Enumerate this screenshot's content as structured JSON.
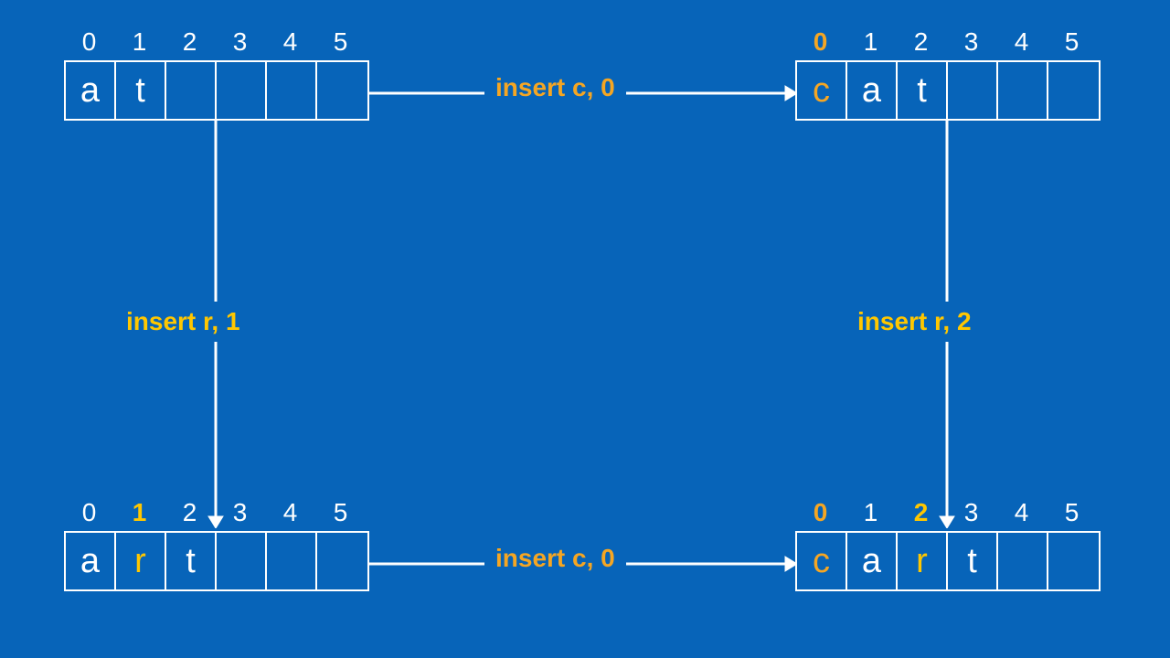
{
  "arrays": {
    "top_left": {
      "indices": [
        "0",
        "1",
        "2",
        "3",
        "4",
        "5"
      ],
      "index_styles": [
        "",
        "",
        "",
        "",
        "",
        ""
      ],
      "cells": [
        "a",
        "t",
        "",
        "",
        "",
        ""
      ],
      "cell_styles": [
        "",
        "",
        "",
        "",
        "",
        ""
      ]
    },
    "top_right": {
      "indices": [
        "0",
        "1",
        "2",
        "3",
        "4",
        "5"
      ],
      "index_styles": [
        "hl-orange",
        "",
        "",
        "",
        "",
        ""
      ],
      "cells": [
        "c",
        "a",
        "t",
        "",
        "",
        ""
      ],
      "cell_styles": [
        "orange",
        "",
        "",
        "",
        "",
        ""
      ]
    },
    "bottom_left": {
      "indices": [
        "0",
        "1",
        "2",
        "3",
        "4",
        "5"
      ],
      "index_styles": [
        "",
        "hl-yellow",
        "",
        "",
        "",
        ""
      ],
      "cells": [
        "a",
        "r",
        "t",
        "",
        "",
        ""
      ],
      "cell_styles": [
        "",
        "yellow",
        "",
        "",
        "",
        ""
      ]
    },
    "bottom_right": {
      "indices": [
        "0",
        "1",
        "2",
        "3",
        "4",
        "5"
      ],
      "index_styles": [
        "hl-orange",
        "",
        "hl-yellow",
        "",
        "",
        ""
      ],
      "cells": [
        "c",
        "a",
        "r",
        "t",
        "",
        ""
      ],
      "cell_styles": [
        "orange",
        "",
        "yellow",
        "",
        "",
        ""
      ]
    }
  },
  "operations": {
    "top": "insert c, 0",
    "bottom": "insert c, 0",
    "left": "insert r, 1",
    "right": "insert r, 2"
  }
}
